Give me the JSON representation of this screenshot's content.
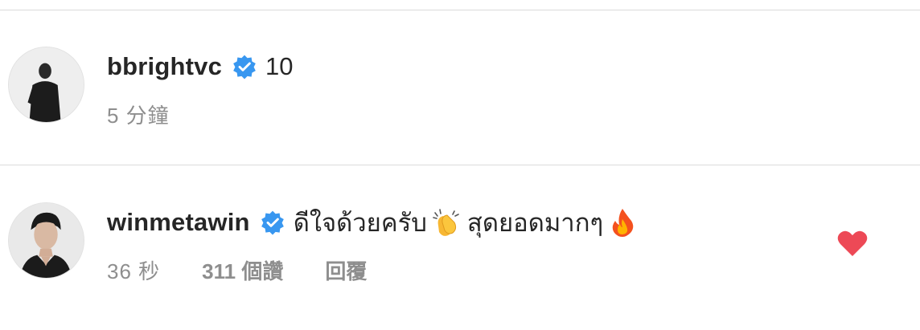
{
  "comments": [
    {
      "username": "bbrightvc",
      "text": "10",
      "time": "5 分鐘",
      "avatar_icon": "avatar-photo",
      "verified_icon": "verified-badge-icon"
    },
    {
      "username": "winmetawin",
      "text_part1": "ดีใจด้วยครับ",
      "emoji1": "clapping-hands-emoji",
      "text_part2": "สุดยอดมากๆ",
      "emoji2": "fire-emoji",
      "time": "36 秒",
      "likes": "311 個讚",
      "reply": "回覆",
      "liked_icon": "heart-icon",
      "verified_icon": "verified-badge-icon"
    }
  ],
  "colors": {
    "text": "#262626",
    "meta": "#8e8e8e",
    "verified": "#3897f0",
    "heart": "#ed4956",
    "divider": "#dbdbdb"
  }
}
